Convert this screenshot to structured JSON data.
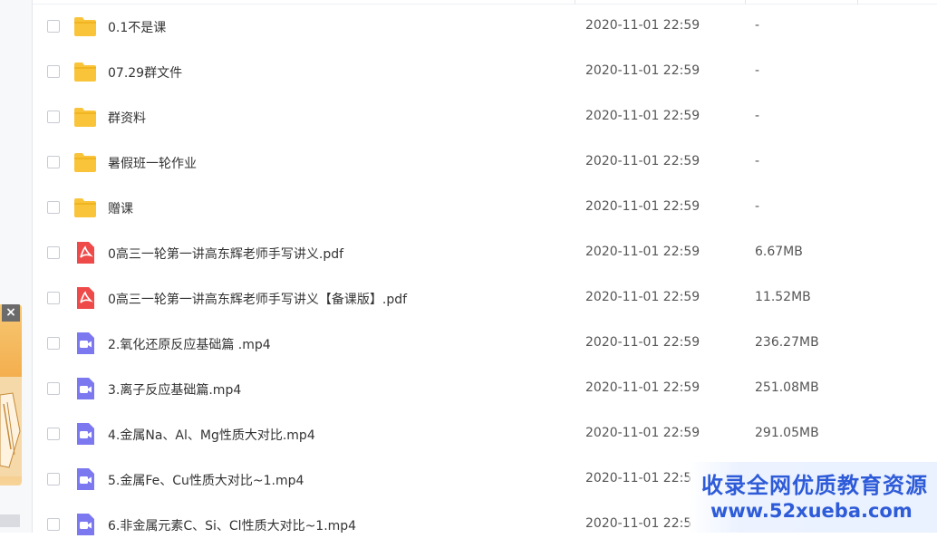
{
  "files": [
    {
      "name": "0.1不是课",
      "date": "2020-11-01 22:59",
      "size": "-",
      "type": "folder"
    },
    {
      "name": "07.29群文件",
      "date": "2020-11-01 22:59",
      "size": "-",
      "type": "folder"
    },
    {
      "name": "群资料",
      "date": "2020-11-01 22:59",
      "size": "-",
      "type": "folder"
    },
    {
      "name": "暑假班一轮作业",
      "date": "2020-11-01 22:59",
      "size": "-",
      "type": "folder"
    },
    {
      "name": "赠课",
      "date": "2020-11-01 22:59",
      "size": "-",
      "type": "folder"
    },
    {
      "name": "0高三一轮第一讲高东辉老师手写讲义.pdf",
      "date": "2020-11-01 22:59",
      "size": "6.67MB",
      "type": "pdf"
    },
    {
      "name": "0高三一轮第一讲高东辉老师手写讲义【备课版】.pdf",
      "date": "2020-11-01 22:59",
      "size": "11.52MB",
      "type": "pdf"
    },
    {
      "name": "2.氧化还原反应基础篇 .mp4",
      "date": "2020-11-01 22:59",
      "size": "236.27MB",
      "type": "video"
    },
    {
      "name": "3.离子反应基础篇.mp4",
      "date": "2020-11-01 22:59",
      "size": "251.08MB",
      "type": "video"
    },
    {
      "name": "4.金属Na、Al、Mg性质大对比.mp4",
      "date": "2020-11-01 22:59",
      "size": "291.05MB",
      "type": "video"
    },
    {
      "name": "5.金属Fe、Cu性质大对比~1.mp4",
      "date": "2020-11-01 22:5",
      "size": "",
      "type": "video"
    },
    {
      "name": "6.非金属元素C、Si、Cl性质大对比~1.mp4",
      "date": "2020-11-01 22:5",
      "size": "",
      "type": "video"
    }
  ],
  "ad": {
    "close_label": "×"
  },
  "watermark": {
    "line1": "收录全网优质教育资源",
    "line2": "www.52xueba.com"
  },
  "colors": {
    "folder": "#f9c43a",
    "pdf": "#ef4a4a",
    "video": "#7b78f0",
    "watermark": "#2e5bd8"
  }
}
